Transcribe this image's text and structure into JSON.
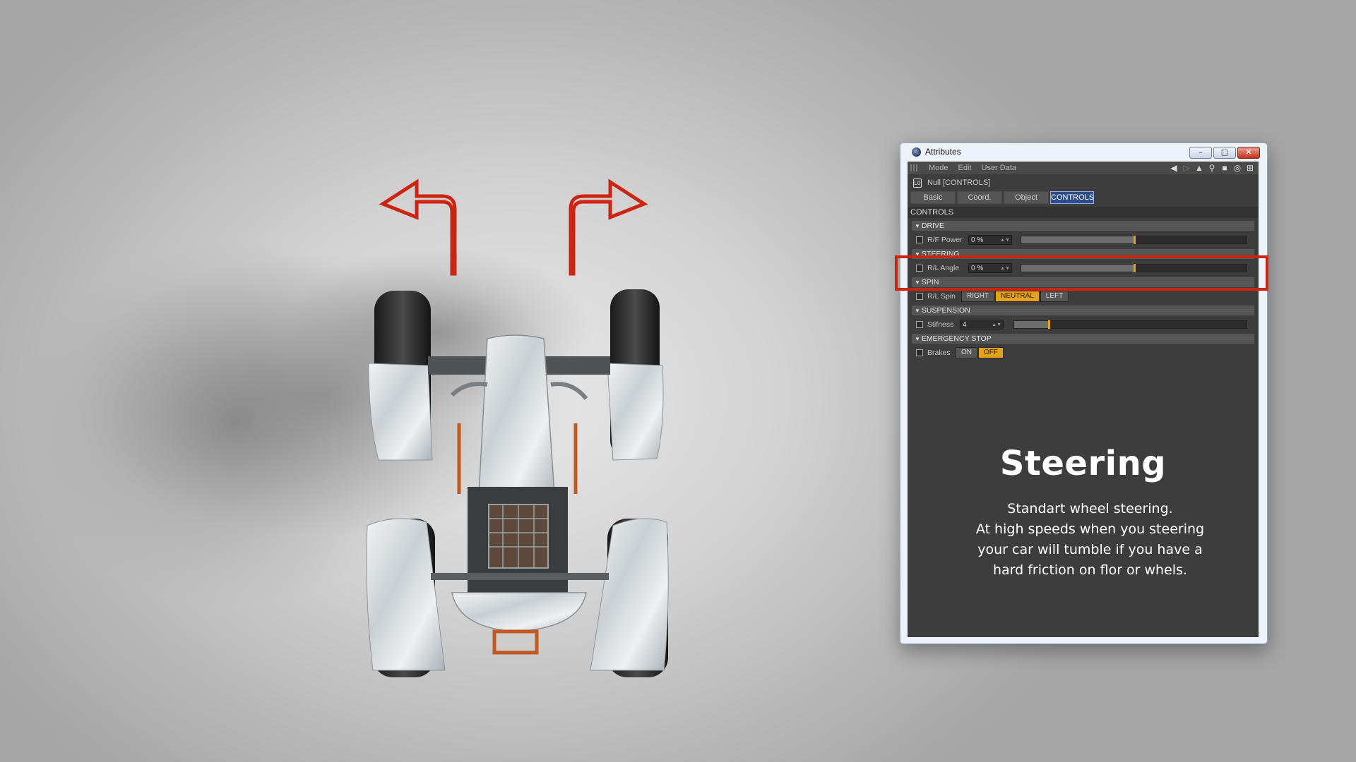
{
  "window": {
    "title": "Attributes",
    "controls": [
      "–",
      "□",
      "✕"
    ]
  },
  "menu": {
    "items": [
      "Mode",
      "Edit",
      "User Data"
    ],
    "tool_icons": [
      "back-arrow-icon",
      "forward-arrow-icon",
      "pointer-icon",
      "search-icon",
      "lock-icon",
      "target-icon",
      "new-panel-icon"
    ]
  },
  "object_label": "Null [CONTROLS]",
  "tabs": [
    {
      "label": "Basic",
      "active": false
    },
    {
      "label": "Coord.",
      "active": false
    },
    {
      "label": "Object",
      "active": false
    },
    {
      "label": "CONTROLS",
      "active": true
    }
  ],
  "section_title": "CONTROLS",
  "groups": {
    "drive": {
      "title": "DRIVE",
      "param_label": "R/F Power",
      "value": "0 %",
      "slider_position": 0.5
    },
    "steering": {
      "title": "STEERING",
      "param_label": "R/L Angle",
      "value": "0 %",
      "slider_position": 0.5
    },
    "spin": {
      "title": "SPIN",
      "param_label": "R/L Spin",
      "options": [
        "RIGHT",
        "NEUTRAL",
        "LEFT"
      ],
      "selected": "NEUTRAL"
    },
    "suspension": {
      "title": "SUSPENSION",
      "param_label": "Stifness",
      "value": "4",
      "slider_position": 0.15
    },
    "emergency": {
      "title": "EMERGENCY STOP",
      "param_label": "Brakes",
      "options": [
        "ON",
        "OFF"
      ],
      "selected": "OFF"
    }
  },
  "info": {
    "heading": "Steering",
    "description_lines": [
      "Standart wheel steering.",
      "At high speeds when you steering",
      "your car will tumble if you have a",
      "hard friction on flor or whels."
    ]
  },
  "colors": {
    "accent_orange": "#e6a215",
    "arrow_red": "#cc2410",
    "panel_bg": "#3d3d3d",
    "active_tab": "#2f4e87"
  }
}
